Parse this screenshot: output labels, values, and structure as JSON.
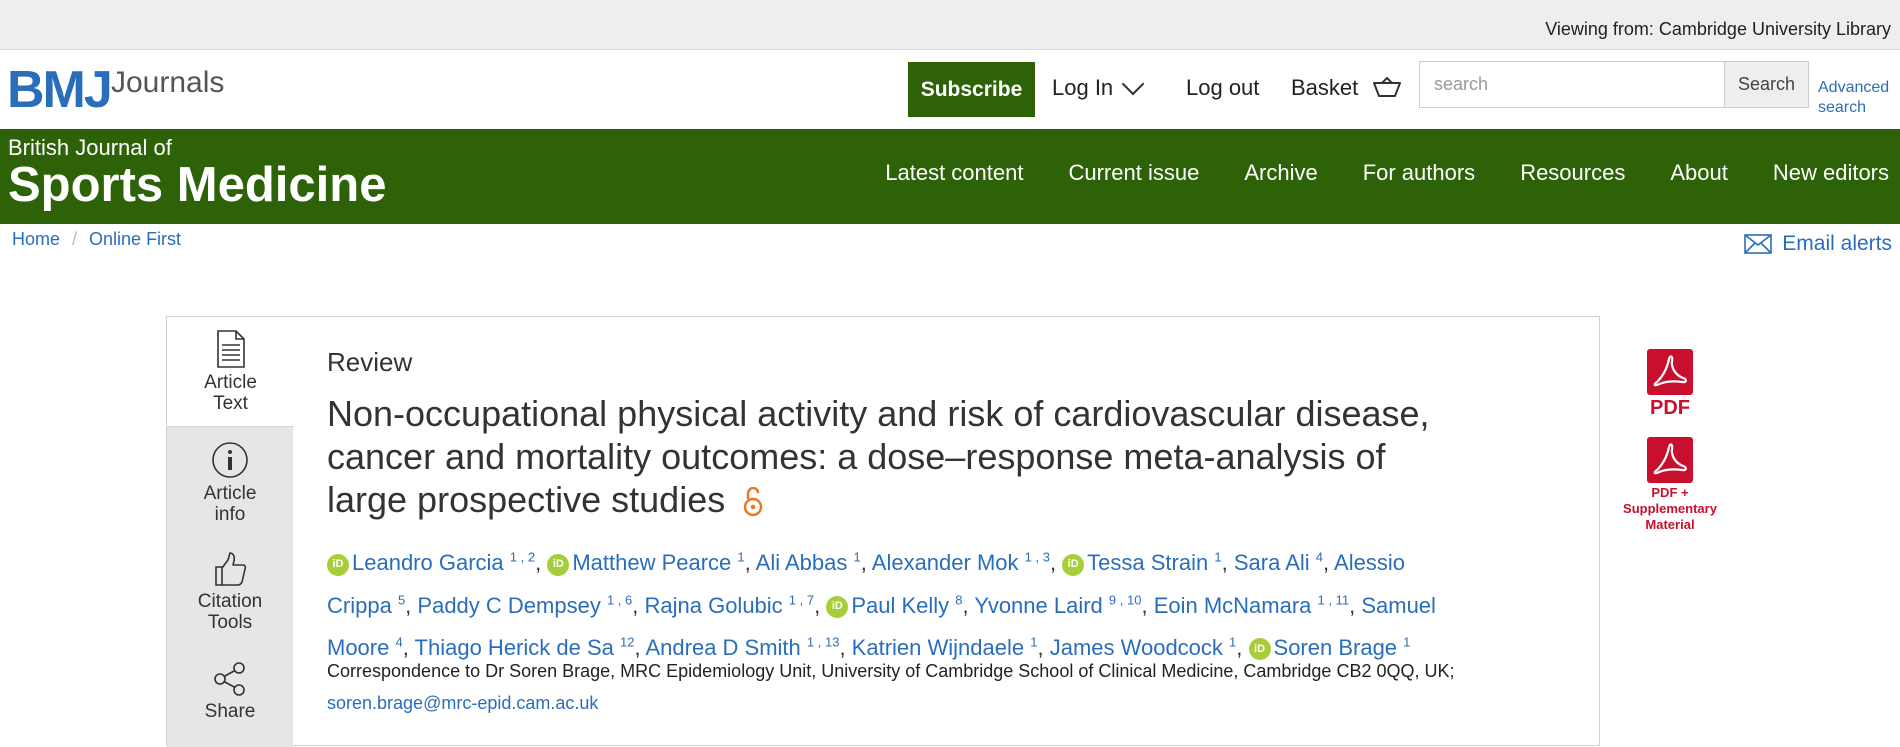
{
  "topbar": {
    "viewing": "Viewing from: Cambridge University Library"
  },
  "header": {
    "logo_bmj": "BMJ",
    "logo_journals": "Journals",
    "subscribe": "Subscribe",
    "login": "Log In",
    "logout": "Log out",
    "basket": "Basket",
    "search_placeholder": "search",
    "search_button": "Search",
    "advanced_line1": "Advanced",
    "advanced_line2": "search"
  },
  "banner": {
    "title_line1": "British Journal of",
    "title_line2": "Sports Medicine",
    "nav": [
      "Latest content",
      "Current issue",
      "Archive",
      "For authors",
      "Resources",
      "About",
      "New editors"
    ]
  },
  "breadcrumb": {
    "home": "Home",
    "separator": "/",
    "current": "Online First"
  },
  "email_alerts": "Email alerts",
  "sidetabs": [
    {
      "line1": "Article",
      "line2": "Text",
      "icon": "document-icon"
    },
    {
      "line1": "Article",
      "line2": "info",
      "icon": "info-icon"
    },
    {
      "line1": "Citation",
      "line2": "Tools",
      "icon": "thumbs-up-icon"
    },
    {
      "line1": "Share",
      "line2": "",
      "icon": "share-icon"
    }
  ],
  "article": {
    "type": "Review",
    "title": "Non-occupational physical activity and risk of cardiovascular disease, cancer and mortality outcomes: a dose–response meta-analysis of large prospective studies",
    "authors": [
      {
        "name": "Leandro Garcia",
        "aff": "1 , 2",
        "orcid": true
      },
      {
        "name": "Matthew Pearce",
        "aff": "1",
        "orcid": true
      },
      {
        "name": "Ali Abbas",
        "aff": "1",
        "orcid": false
      },
      {
        "name": "Alexander Mok",
        "aff": "1 , 3",
        "orcid": false
      },
      {
        "name": "Tessa Strain",
        "aff": "1",
        "orcid": true
      },
      {
        "name": "Sara Ali",
        "aff": "4",
        "orcid": false
      },
      {
        "name": "Alessio Crippa",
        "aff": "5",
        "orcid": false
      },
      {
        "name": "Paddy C Dempsey",
        "aff": "1 , 6",
        "orcid": false
      },
      {
        "name": "Rajna Golubic",
        "aff": "1 , 7",
        "orcid": false
      },
      {
        "name": "Paul Kelly",
        "aff": "8",
        "orcid": true
      },
      {
        "name": "Yvonne Laird",
        "aff": "9 , 10",
        "orcid": false
      },
      {
        "name": "Eoin McNamara",
        "aff": "1 , 11",
        "orcid": false
      },
      {
        "name": "Samuel Moore",
        "aff": "4",
        "orcid": false
      },
      {
        "name": "Thiago Herick de Sa",
        "aff": "12",
        "orcid": false
      },
      {
        "name": "Andrea D Smith",
        "aff": "1 , 13",
        "orcid": false
      },
      {
        "name": "Katrien Wijndaele",
        "aff": "1",
        "orcid": false
      },
      {
        "name": "James Woodcock",
        "aff": "1",
        "orcid": false
      },
      {
        "name": "Soren Brage",
        "aff": "1",
        "orcid": true
      }
    ],
    "correspondence": "Correspondence to Dr Soren Brage, MRC Epidemiology Unit, University of Cambridge School of Clinical Medicine, Cambridge CB2 0QQ, UK;",
    "email": "soren.brage@mrc-epid.cam.ac.uk"
  },
  "downloads": {
    "pdf": "PDF",
    "pdf_supp_line1": "PDF +",
    "pdf_supp_line2": "Supplementary",
    "pdf_supp_line3": "Material"
  },
  "colors": {
    "brand_green": "#2e6209",
    "link_blue": "#2a6ebb",
    "pdf_red": "#c8102e",
    "orcid_green": "#a6ce39",
    "oa_orange": "#e87722"
  }
}
